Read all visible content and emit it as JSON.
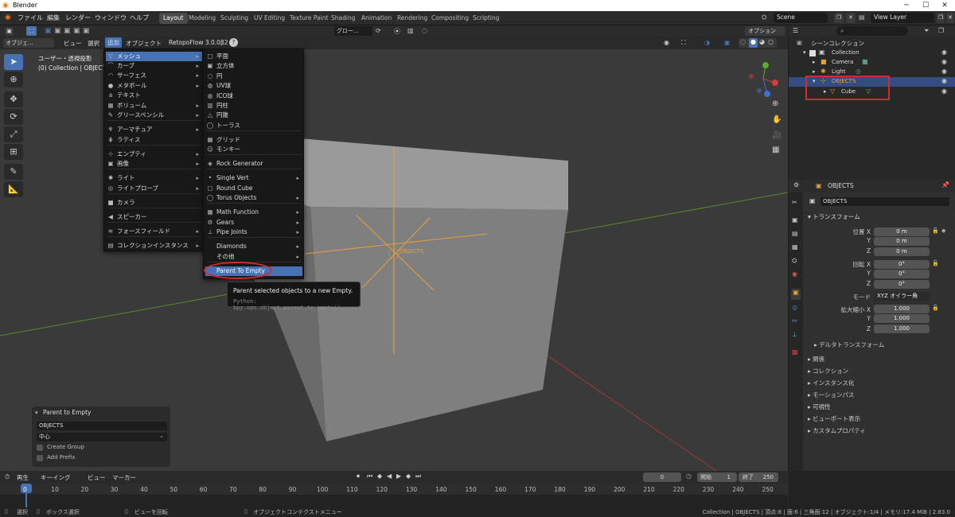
{
  "window": {
    "title": "Blender",
    "controls": [
      "─",
      "☐",
      "✕"
    ]
  },
  "topbar": {
    "menus": [
      "ファイル",
      "編集",
      "レンダー",
      "ウィンドウ",
      "ヘルプ"
    ],
    "workspaces": [
      "Layout",
      "Modeling",
      "Sculpting",
      "UV Editing",
      "Texture Paint",
      "Shading",
      "Animation",
      "Rendering",
      "Compositing",
      "Scripting"
    ],
    "active_workspace": "Layout",
    "scene": "Scene",
    "view_layer": "View Layer"
  },
  "viewport_header": {
    "mode": "オブジェ...",
    "menus": [
      "ビュー",
      "選択",
      "追加",
      "オブジェクト"
    ],
    "addon": "RetopoFlow 3.0.0β2",
    "transform_orientation": "グロー...",
    "options": "オプション"
  },
  "viewport": {
    "view_name": "ユーザー・透視投影",
    "collection_info": "(0) Collection | OBJECTS",
    "empty_label": "OBJECTS"
  },
  "add_menu": {
    "items": [
      {
        "icon": "▽",
        "label": "メッシュ",
        "submenu": true,
        "highlight": true
      },
      {
        "icon": "⌒",
        "label": "カーブ",
        "submenu": true
      },
      {
        "icon": "◠",
        "label": "サーフェス",
        "submenu": true
      },
      {
        "icon": "●",
        "label": "メタボール",
        "submenu": true
      },
      {
        "icon": "a",
        "label": "テキスト",
        "submenu": false
      },
      {
        "icon": "▦",
        "label": "ボリューム",
        "submenu": true
      },
      {
        "icon": "✎",
        "label": "グリースペンシル",
        "submenu": true
      },
      {
        "icon": "♆",
        "label": "アーマチュア",
        "submenu": true
      },
      {
        "icon": "⋕",
        "label": "ラティス",
        "submenu": false
      },
      {
        "icon": "⊹",
        "label": "エンプティ",
        "submenu": true
      },
      {
        "icon": "▣",
        "label": "画像",
        "submenu": true
      },
      {
        "icon": "✺",
        "label": "ライト",
        "submenu": true
      },
      {
        "icon": "◎",
        "label": "ライトプローブ",
        "submenu": true
      },
      {
        "icon": "■",
        "label": "カメラ",
        "submenu": false
      },
      {
        "icon": "◀",
        "label": "スピーカー",
        "submenu": false
      },
      {
        "icon": "≋",
        "label": "フォースフィールド",
        "submenu": true
      },
      {
        "icon": "▤",
        "label": "コレクションインスタンス",
        "submenu": true
      }
    ]
  },
  "mesh_menu": {
    "items": [
      {
        "icon": "□",
        "label": "平面"
      },
      {
        "icon": "▣",
        "label": "立方体"
      },
      {
        "icon": "○",
        "label": "円"
      },
      {
        "icon": "◍",
        "label": "UV球"
      },
      {
        "icon": "◍",
        "label": "ICO球"
      },
      {
        "icon": "▥",
        "label": "円柱"
      },
      {
        "icon": "△",
        "label": "円錐"
      },
      {
        "icon": "◯",
        "label": "トーラス"
      },
      {
        "icon": "▦",
        "label": "グリッド"
      },
      {
        "icon": "☺",
        "label": "モンキー"
      },
      {
        "icon": "◈",
        "label": "Rock Generator"
      },
      {
        "icon": "•",
        "label": "Single Vert",
        "submenu": true
      },
      {
        "icon": "▢",
        "label": "Round Cube"
      },
      {
        "icon": "◯",
        "label": "Torus Objects",
        "submenu": true
      },
      {
        "icon": "▦",
        "label": "Math Function",
        "submenu": true
      },
      {
        "icon": "⚙",
        "label": "Gears",
        "submenu": true
      },
      {
        "icon": "⊥",
        "label": "Pipe Joints",
        "submenu": true
      },
      {
        "icon": "",
        "label": "Diamonds",
        "submenu": true
      },
      {
        "icon": "",
        "label": "その他",
        "submenu": true
      },
      {
        "icon": "",
        "label": "Parent To Empty",
        "highlight": true
      }
    ]
  },
  "tooltip": {
    "text": "Parent selected objects to a new Empty.",
    "python": "Python: bpy.ops.object.parent_to_empty()"
  },
  "redo_panel": {
    "title": "Parent to Empty",
    "name": "OBJECTS",
    "location": "中心",
    "create_group": "Create Group",
    "add_prefix": "Add Prefix"
  },
  "outliner": {
    "root": "シーンコレクション",
    "items": [
      {
        "label": "Collection",
        "depth": 0
      },
      {
        "label": "Camera",
        "depth": 1
      },
      {
        "label": "Light",
        "depth": 1
      },
      {
        "label": "OBJECTS",
        "depth": 1,
        "selected": true
      },
      {
        "label": "Cube",
        "depth": 2
      }
    ]
  },
  "properties": {
    "object_name": "OBJECTS",
    "object_field": "OBJECTS",
    "transform_header": "トランスフォーム",
    "location_label": "位置 X",
    "rotation_label": "回転 X",
    "scale_label": "拡大縮小 X",
    "axis_y": "Y",
    "axis_z": "Z",
    "location": [
      "0 m",
      "0 m",
      "0 m"
    ],
    "rotation": [
      "0°",
      "0°",
      "0°"
    ],
    "mode_label": "モード",
    "mode_value": "XYZ オイラー角",
    "scale": [
      "1.000",
      "1.000",
      "1.000"
    ],
    "sections": [
      "デルタトランスフォーム",
      "関係",
      "コレクション",
      "インスタンス化",
      "モーションパス",
      "可視性",
      "ビューポート表示",
      "カスタムプロパティ"
    ]
  },
  "timeline": {
    "menus": [
      "再生",
      "キーイング",
      "ビュー",
      "マーカー"
    ],
    "current_frame": "0",
    "start_label": "開始",
    "start": "1",
    "end_label": "終了",
    "end": "250",
    "ticks": [
      "0",
      "10",
      "20",
      "30",
      "40",
      "50",
      "60",
      "70",
      "80",
      "90",
      "100",
      "110",
      "120",
      "130",
      "140",
      "150",
      "160",
      "170",
      "180",
      "190",
      "200",
      "210",
      "220",
      "230",
      "240",
      "250"
    ]
  },
  "statusbar": {
    "left": [
      "選択",
      "ボックス選択",
      "ビューを回転",
      "オブジェクトコンテクストメニュー"
    ],
    "right": "Collection | OBJECTS | 頂点:8 | 面:6 | 三角面:12 | オブジェクト:1/4 | メモリ:17.4 MiB | 2.83.0"
  },
  "colors": {
    "accent": "#4772b3",
    "highlight_red": "#d42a2a",
    "empty_orange": "#e7a03a"
  }
}
